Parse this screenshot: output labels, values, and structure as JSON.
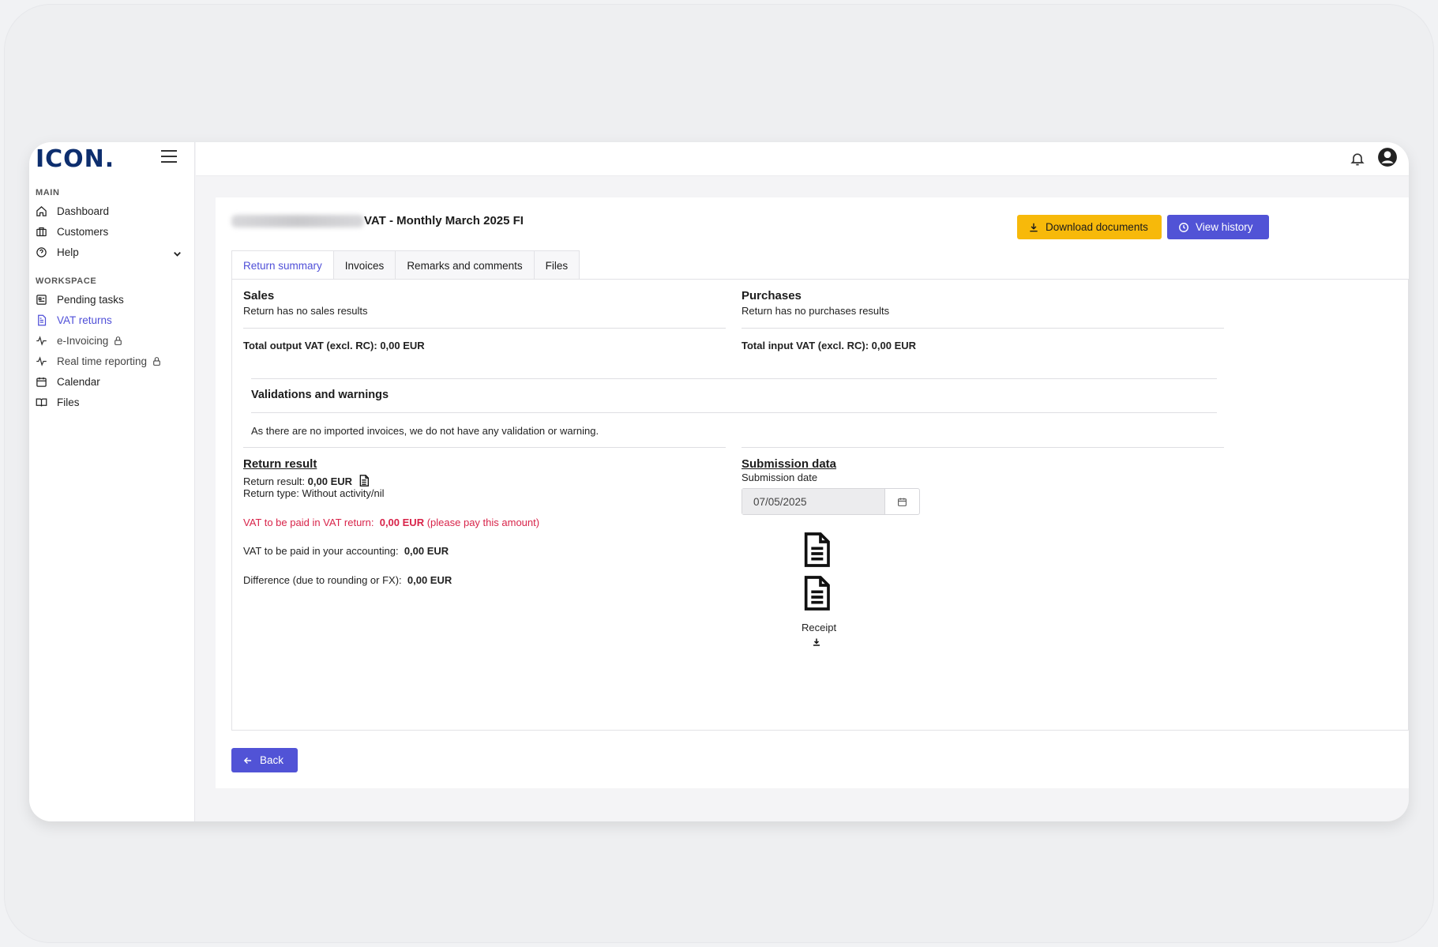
{
  "app": {
    "logo": "ICON."
  },
  "sidebar": {
    "main_label": "MAIN",
    "workspace_label": "WORKSPACE",
    "main_items": [
      {
        "label": "Dashboard",
        "icon": "home-icon"
      },
      {
        "label": "Customers",
        "icon": "briefcase-icon"
      },
      {
        "label": "Help",
        "icon": "help-circle-icon"
      }
    ],
    "workspace_items": [
      {
        "label": "Pending tasks",
        "icon": "tasks-icon"
      },
      {
        "label": "VAT returns",
        "icon": "document-icon",
        "active": true
      },
      {
        "label": "e-Invoicing",
        "icon": "activity-icon",
        "locked": true
      },
      {
        "label": "Real time reporting",
        "icon": "activity-icon",
        "locked": true
      },
      {
        "label": "Calendar",
        "icon": "calendar-icon"
      },
      {
        "label": "Files",
        "icon": "book-icon"
      }
    ]
  },
  "header": {
    "title": "VAT - Monthly March 2025 FI",
    "download_label": "Download documents",
    "history_label": "View history"
  },
  "tabs": [
    "Return summary",
    "Invoices",
    "Remarks and comments",
    "Files"
  ],
  "sales": {
    "title": "Sales",
    "empty": "Return has no sales results",
    "total": "Total output VAT (excl. RC): 0,00 EUR"
  },
  "purchases": {
    "title": "Purchases",
    "empty": "Return has no purchases results",
    "total": "Total input VAT (excl. RC): 0,00 EUR"
  },
  "validations": {
    "title": "Validations and warnings",
    "message": "As there are no imported invoices, we do not have any validation or warning."
  },
  "return_result": {
    "title": "Return result",
    "result_label": "Return result:",
    "result_value": "0,00 EUR",
    "type_label": "Return type:",
    "type_value": "Without activity/nil",
    "vat_paid_label": "VAT to be paid in VAT return:",
    "vat_paid_value": "0,00 EUR",
    "vat_paid_note": "(please pay this amount)",
    "accounting_label": "VAT to be paid in your accounting:",
    "accounting_value": "0,00 EUR",
    "difference_label": "Difference (due to rounding or FX):",
    "difference_value": "0,00 EUR"
  },
  "submission": {
    "title": "Submission data",
    "date_label": "Submission date",
    "date_value": "07/05/2025",
    "receipt_label": "Receipt"
  },
  "footer": {
    "back_label": "Back"
  },
  "colors": {
    "accent": "#5153d6",
    "warning": "#f7b90a",
    "danger": "#d8244a"
  }
}
